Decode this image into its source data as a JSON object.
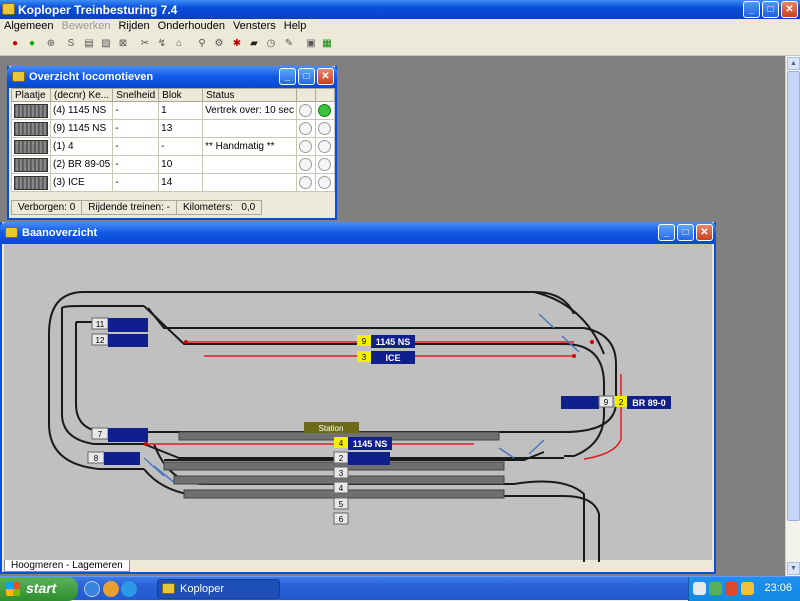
{
  "app": {
    "title": "Koploper Treinbesturing 7.4"
  },
  "menu": [
    {
      "label": "Algemeen",
      "enabled": true
    },
    {
      "label": "Bewerken",
      "enabled": false
    },
    {
      "label": "Rijden",
      "enabled": true
    },
    {
      "label": "Onderhouden",
      "enabled": true
    },
    {
      "label": "Vensters",
      "enabled": true
    },
    {
      "label": "Help",
      "enabled": true
    }
  ],
  "loco_window": {
    "title": "Overzicht locomotieven",
    "columns": [
      "Plaatje",
      "(decnr) Ke...",
      "Snelheid",
      "Blok",
      "Status",
      "",
      ""
    ],
    "rows": [
      {
        "name": "(4) 1145 NS",
        "speed": "-",
        "block": "1",
        "status": "Vertrek over: 10 sec",
        "active": true
      },
      {
        "name": "(9) 1145 NS",
        "speed": "-",
        "block": "13",
        "status": "",
        "active": false
      },
      {
        "name": "(1) 4",
        "speed": "-",
        "block": "-",
        "status": "** Handmatig **",
        "active": false
      },
      {
        "name": "(2) BR 89-05",
        "speed": "-",
        "block": "10",
        "status": "",
        "active": false
      },
      {
        "name": "(3) ICE",
        "speed": "-",
        "block": "14",
        "status": "",
        "active": false
      }
    ],
    "status": {
      "hidden": "Verborgen: 0",
      "driving": "Rijdende treinen: -",
      "km_label": "Kilometers:",
      "km_value": "0,0"
    }
  },
  "baan_window": {
    "title": "Baanoverzicht",
    "tab": "Hoogmeren - Lagemeren",
    "station_label": "Station",
    "blocks": [
      {
        "num": "11",
        "loco_num": "",
        "loco": ""
      },
      {
        "num": "12",
        "loco_num": "",
        "loco": ""
      },
      {
        "num": "7",
        "loco_num": "",
        "loco": ""
      },
      {
        "num": "8",
        "loco_num": "",
        "loco": ""
      },
      {
        "num": "9",
        "loco_num": "2",
        "loco": "BR 89-0"
      },
      {
        "num": "2",
        "loco_num": "",
        "loco": ""
      },
      {
        "num": "3",
        "loco_num": "",
        "loco": ""
      },
      {
        "num": "4",
        "loco_num": "",
        "loco": ""
      },
      {
        "num": "5",
        "loco_num": "",
        "loco": ""
      },
      {
        "num": "6",
        "loco_num": "",
        "loco": ""
      }
    ],
    "train_labels": [
      {
        "num": "9",
        "name": "1145 NS"
      },
      {
        "num": "3",
        "name": "ICE"
      },
      {
        "num": "4",
        "name": "1145 NS"
      }
    ]
  },
  "taskbar": {
    "start": "start",
    "task": "Koploper",
    "clock": "23:06"
  },
  "colors": {
    "track": "#1a1a1a",
    "route": "#e02020",
    "block": "#0f1f8c",
    "label_yellow": "#f5f000",
    "turnout": "#4a78c0"
  }
}
